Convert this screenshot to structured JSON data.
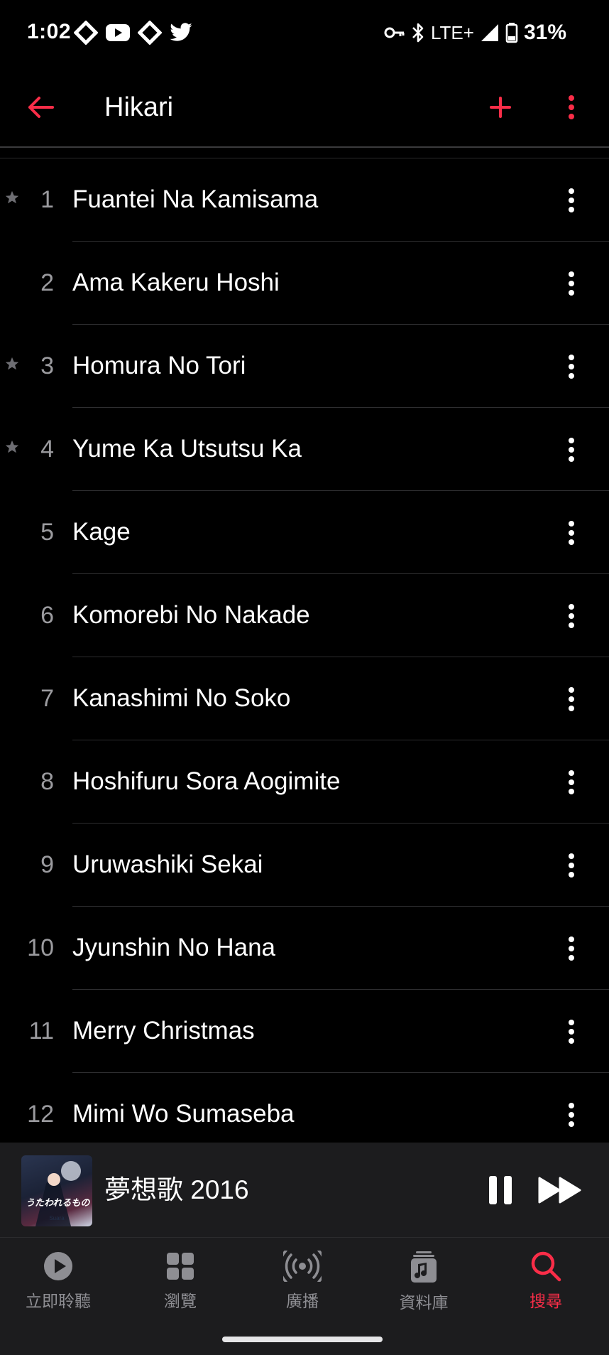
{
  "status_bar": {
    "time": "1:02",
    "network": "LTE+",
    "battery": "31%",
    "icons_left": [
      "diamond-notification-icon",
      "youtube-icon",
      "diamond-notification-icon",
      "twitter-icon"
    ],
    "icons_right": [
      "key-icon",
      "bluetooth-icon",
      "signal-icon",
      "battery-icon"
    ]
  },
  "header": {
    "title": "Hikari",
    "accent_color": "#fa2d48"
  },
  "tracks": [
    {
      "number": "1",
      "title": "Fuantei Na Kamisama",
      "starred": true
    },
    {
      "number": "2",
      "title": "Ama Kakeru Hoshi",
      "starred": false
    },
    {
      "number": "3",
      "title": "Homura No Tori",
      "starred": true
    },
    {
      "number": "4",
      "title": "Yume Ka Utsutsu Ka",
      "starred": true
    },
    {
      "number": "5",
      "title": "Kage",
      "starred": false
    },
    {
      "number": "6",
      "title": "Komorebi No Nakade",
      "starred": false
    },
    {
      "number": "7",
      "title": "Kanashimi No Soko",
      "starred": false
    },
    {
      "number": "8",
      "title": "Hoshifuru Sora Aogimite",
      "starred": false
    },
    {
      "number": "9",
      "title": "Uruwashiki Sekai",
      "starred": false
    },
    {
      "number": "10",
      "title": "Jyunshin No Hana",
      "starred": false
    },
    {
      "number": "11",
      "title": "Merry Christmas",
      "starred": false
    },
    {
      "number": "12",
      "title": "Mimi Wo Sumaseba",
      "starred": false
    }
  ],
  "now_playing": {
    "title": "夢想歌 2016",
    "artwork_title": "うたわれるもの",
    "artwork_subtitle": "Suara"
  },
  "tabs": [
    {
      "label": "立即聆聽",
      "icon": "play-circle-icon",
      "active": false
    },
    {
      "label": "瀏覽",
      "icon": "grid-icon",
      "active": false
    },
    {
      "label": "廣播",
      "icon": "radio-icon",
      "active": false
    },
    {
      "label": "資料庫",
      "icon": "library-icon",
      "active": false
    },
    {
      "label": "搜尋",
      "icon": "search-icon",
      "active": true
    }
  ]
}
